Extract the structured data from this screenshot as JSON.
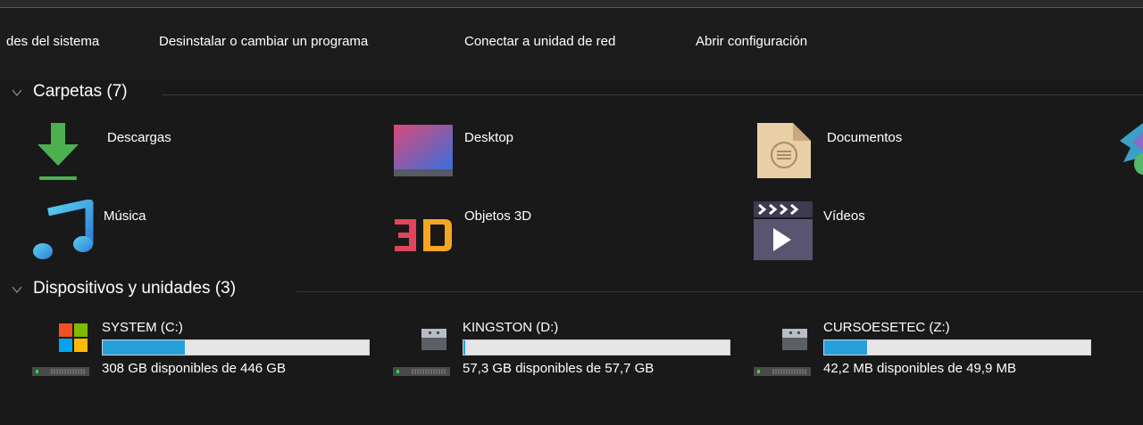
{
  "toolbar": {
    "items": [
      "des del sistema",
      "Desinstalar o cambiar un programa",
      "Conectar a unidad de red",
      "Abrir configuración"
    ]
  },
  "folders_section": {
    "title": "Carpetas (7)",
    "items": [
      {
        "label": "Descargas",
        "icon": "download-folder-icon"
      },
      {
        "label": "Desktop",
        "icon": "desktop-folder-icon"
      },
      {
        "label": "Documentos",
        "icon": "documents-folder-icon"
      },
      {
        "label": "Música",
        "icon": "music-folder-icon"
      },
      {
        "label": "Objetos 3D",
        "icon": "3d-objects-folder-icon"
      },
      {
        "label": "Vídeos",
        "icon": "videos-folder-icon"
      }
    ]
  },
  "devices_section": {
    "title": "Dispositivos y unidades (3)",
    "drives": [
      {
        "name": "SYSTEM (C:)",
        "free_text": "308 GB disponibles de 446 GB",
        "used_fraction": 0.31,
        "icon": "windows-drive-icon"
      },
      {
        "name": "KINGSTON (D:)",
        "free_text": "57,3 GB disponibles de 57,7 GB",
        "used_fraction": 0.007,
        "icon": "usb-drive-icon"
      },
      {
        "name": "CURSOESETEC (Z:)",
        "free_text": "42,2 MB disponibles de 49,9 MB",
        "used_fraction": 0.16,
        "icon": "usb-drive-icon"
      }
    ]
  },
  "colors": {
    "background": "#191919",
    "toolbar": "#1c1c1c",
    "usage_bar_fill": "#26a0da",
    "usage_bar_track": "#e6e6e6",
    "text": "#ffffff"
  }
}
